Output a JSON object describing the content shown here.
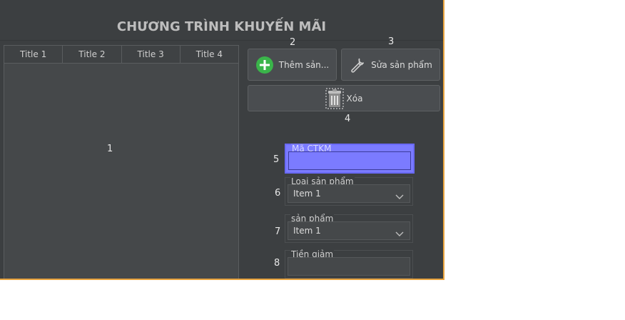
{
  "page": {
    "title": "CHƯƠNG TRÌNH KHUYẾN MÃI"
  },
  "table": {
    "columns": [
      "Title 1",
      "Title 2",
      "Title 3",
      "Title 4"
    ],
    "rows": []
  },
  "markers": {
    "m1": "1",
    "m2": "2",
    "m3": "3",
    "m4": "4",
    "m5": "5",
    "m6": "6",
    "m7": "7",
    "m8": "8"
  },
  "buttons": {
    "add_label": "Thêm sản...",
    "edit_label": "Sửa sản phẩm",
    "delete_label": "Xóa"
  },
  "form": {
    "ma_ctkm": {
      "legend": "Mã CTKM",
      "value": ""
    },
    "loai_san_pham": {
      "legend": "Loại sản phẩm",
      "value": "Item 1"
    },
    "san_pham": {
      "legend": "sản phẩm",
      "value": "Item 1"
    },
    "tien_giam": {
      "legend": "Tiền giảm",
      "value": ""
    }
  },
  "colors": {
    "accent_border": "#e8a33d",
    "highlight": "#7b7bff",
    "add_icon": "#3ab54a"
  },
  "icons": {
    "add": "plus-circle-icon",
    "edit": "wrench-icon",
    "delete": "trash-icon",
    "dropdown": "chevron-down-icon"
  }
}
